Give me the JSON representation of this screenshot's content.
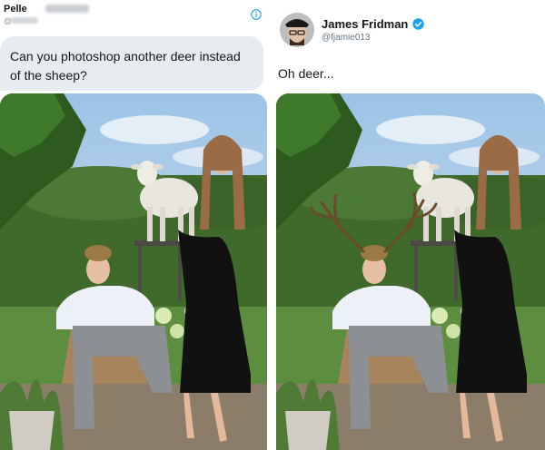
{
  "left_tweet": {
    "user_name": "Pelle",
    "handle_prefix": "@",
    "text": "Can you photoshop another deer instead of the sheep?"
  },
  "right_tweet": {
    "user_name": "James Fridman",
    "handle": "@fjamie013",
    "text": "Oh deer..."
  },
  "colors": {
    "twitter_blue": "#1da1f2",
    "bubble_background": "#e6ecf0",
    "text_primary": "#14171a",
    "text_secondary": "#657786"
  },
  "icons": {
    "info": "info-icon",
    "verified": "verified-badge-icon"
  }
}
